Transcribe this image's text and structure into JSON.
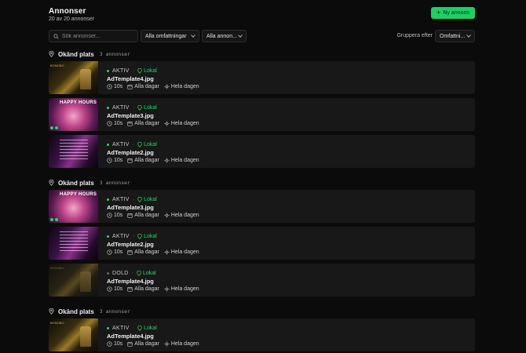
{
  "header": {
    "title": "Annonser",
    "subtitle": "20 av 20 annonser",
    "new_button_label": "Ny annons"
  },
  "filters": {
    "search_placeholder": "Sök annonser...",
    "coverage_select": "Alla omfattningar",
    "ads_select": "Alla annon...",
    "group_by_label": "Gruppera efter",
    "group_by_select": "Omfattni..."
  },
  "groups": [
    {
      "title": "Okänd plats",
      "count": "3 annonser",
      "cards": [
        {
          "status": "AKTIV",
          "location": "Lokal",
          "filename": "AdTemplate4.jpg",
          "duration": "10s",
          "days": "Alla dagar",
          "time": "Hela dagen",
          "thumb_brand": "BONOBO"
        },
        {
          "status": "AKTIV",
          "location": "Lokal",
          "filename": "AdTemplate3.jpg",
          "duration": "10s",
          "days": "Alla dagar",
          "time": "Hela dagen",
          "thumb_title": "HAPPY HOURS"
        },
        {
          "status": "AKTIV",
          "location": "Lokal",
          "filename": "AdTemplate2.jpg",
          "duration": "10s",
          "days": "Alla dagar",
          "time": "Hela dagen"
        }
      ]
    },
    {
      "title": "Okänd plats",
      "count": "3 annonser",
      "cards": [
        {
          "status": "AKTIV",
          "location": "Lokal",
          "filename": "AdTemplate3.jpg",
          "duration": "10s",
          "days": "Alla dagar",
          "time": "Hela dagen",
          "thumb_title": "HAPPY HOURS"
        },
        {
          "status": "AKTIV",
          "location": "Lokal",
          "filename": "AdTemplate2.jpg",
          "duration": "10s",
          "days": "Alla dagar",
          "time": "Hela dagen"
        },
        {
          "status": "DOLD",
          "location": "Lokal",
          "filename": "AdTemplate4.jpg",
          "duration": "10s",
          "days": "Alla dagar",
          "time": "Hela dagen",
          "thumb_brand": "BONOBO"
        }
      ]
    },
    {
      "title": "Okänd plats",
      "count": "3 annonser",
      "cards": [
        {
          "status": "AKTIV",
          "location": "Lokal",
          "filename": "AdTemplate4.jpg",
          "duration": "10s",
          "days": "Alla dagar",
          "time": "Hela dagen",
          "thumb_brand": "BONOBO"
        }
      ]
    }
  ],
  "colors": {
    "accent": "#1fcf63",
    "active_dot": "#2ed16b",
    "background": "#0b0b0b",
    "card": "#181818"
  },
  "icons": {
    "new_button": "plus-icon",
    "search": "search-icon",
    "group": "location-pin-icon",
    "duration": "clock-icon",
    "days": "calendar-icon",
    "time": "sun-icon"
  }
}
